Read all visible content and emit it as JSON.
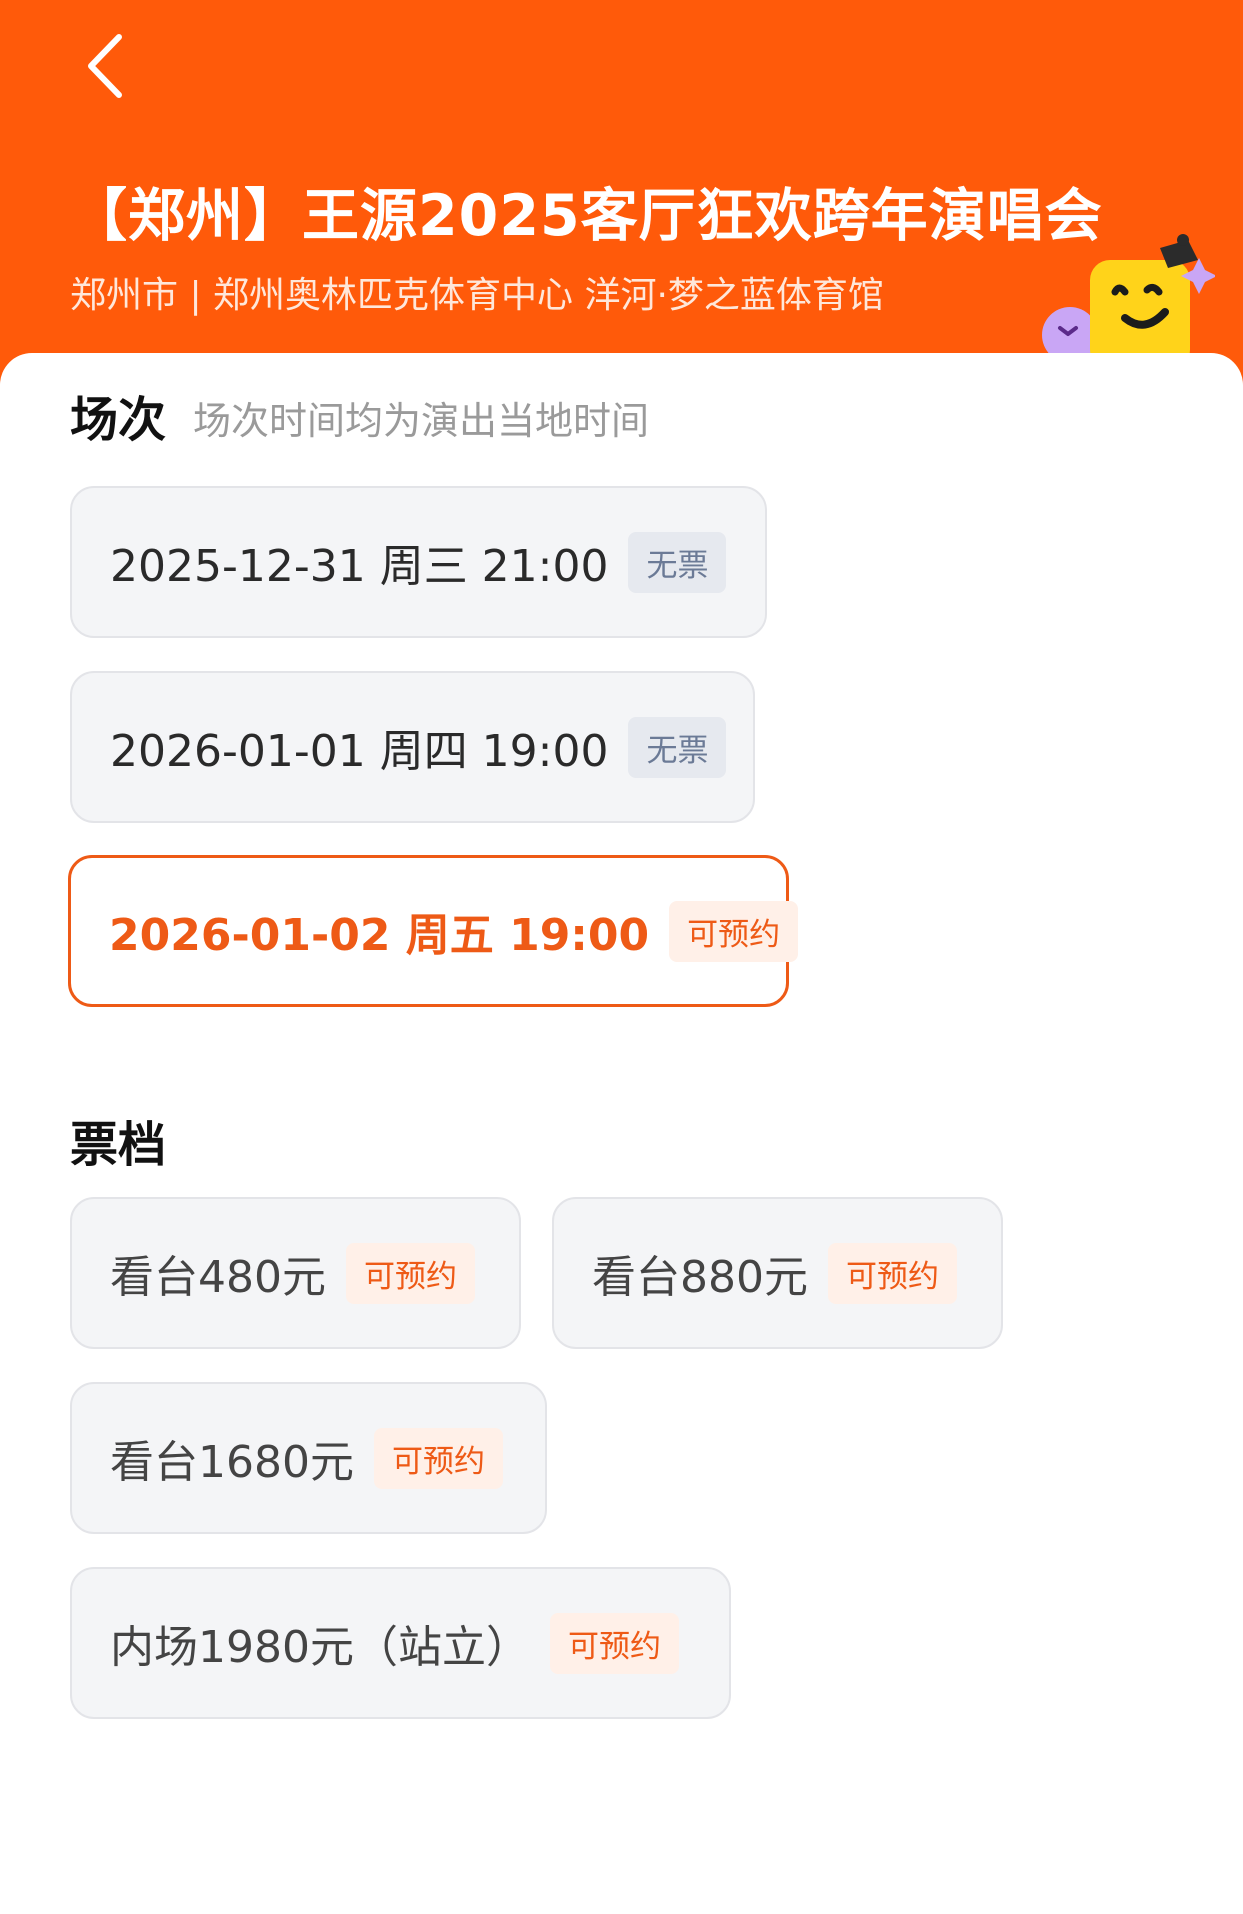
{
  "header": {
    "title": "【郑州】王源2025客厅狂欢跨年演唱会",
    "subtitle": "郑州市 | 郑州奥林匹克体育中心 洋河·梦之蓝体育馆",
    "back_icon": "chevron-left-icon",
    "mascot_icon": "mascot-face-icon",
    "bg_color": "#ff5a0a"
  },
  "sessions": {
    "title": "场次",
    "hint": "场次时间均为演出当地时间",
    "items": [
      {
        "label": "2025-12-31  周三 21:00",
        "badge": "无票",
        "status": "sold-out"
      },
      {
        "label": "2026-01-01 周四 19:00",
        "badge": "无票",
        "status": "sold-out"
      },
      {
        "label": "2026-01-02 周五 19:00",
        "badge": "可预约",
        "status": "selected"
      }
    ]
  },
  "tickets": {
    "title": "票档",
    "items": [
      {
        "label": "看台480元",
        "badge": "可预约"
      },
      {
        "label": "看台880元",
        "badge": "可预约"
      },
      {
        "label": "看台1680元",
        "badge": "可预约"
      },
      {
        "label": "内场1980元（站立）",
        "badge": "可预约"
      }
    ]
  },
  "colors": {
    "accent": "#ee5a16",
    "sold_out_badge_bg": "#e6e9ef",
    "sold_out_badge_text": "#6b7a96",
    "available_badge_bg": "#fff0e8"
  }
}
